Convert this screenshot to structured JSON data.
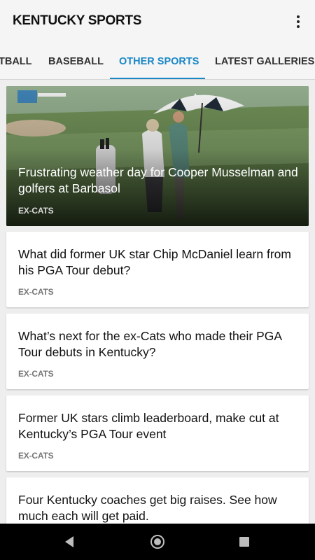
{
  "app_bar": {
    "title": "KENTUCKY SPORTS",
    "menu_icon": "overflow-menu-icon"
  },
  "tabs": [
    {
      "label": "FOOTBALL",
      "visible_text": "TBALL",
      "active": false
    },
    {
      "label": "BASEBALL",
      "active": false
    },
    {
      "label": "OTHER SPORTS",
      "active": true
    },
    {
      "label": "LATEST GALLERIES",
      "active": false
    }
  ],
  "feed": {
    "hero": {
      "title": "Frustrating weather day for Cooper Musselman and golfers at Barbasol",
      "tag": "EX-CATS"
    },
    "articles": [
      {
        "title": "What did former UK star Chip McDaniel learn from his PGA Tour debut?",
        "tag": "EX-CATS"
      },
      {
        "title": "What’s next for the ex-Cats who made their PGA Tour debuts in Kentucky?",
        "tag": "EX-CATS"
      },
      {
        "title": "Former UK stars climb leaderboard, make cut at Kentucky’s PGA Tour event",
        "tag": "EX-CATS"
      },
      {
        "title": "Four Kentucky coaches get big raises. See how much each will get paid.",
        "tag": ""
      }
    ]
  },
  "nav_bar": {
    "back_icon": "back-triangle-icon",
    "home_icon": "home-circle-icon",
    "recents_icon": "recents-square-icon"
  },
  "colors": {
    "accent": "#1a87c5",
    "app_bar_bg": "#f5f5f5",
    "feed_bg": "#eeeeee",
    "nav_bar_bg": "#000000"
  }
}
